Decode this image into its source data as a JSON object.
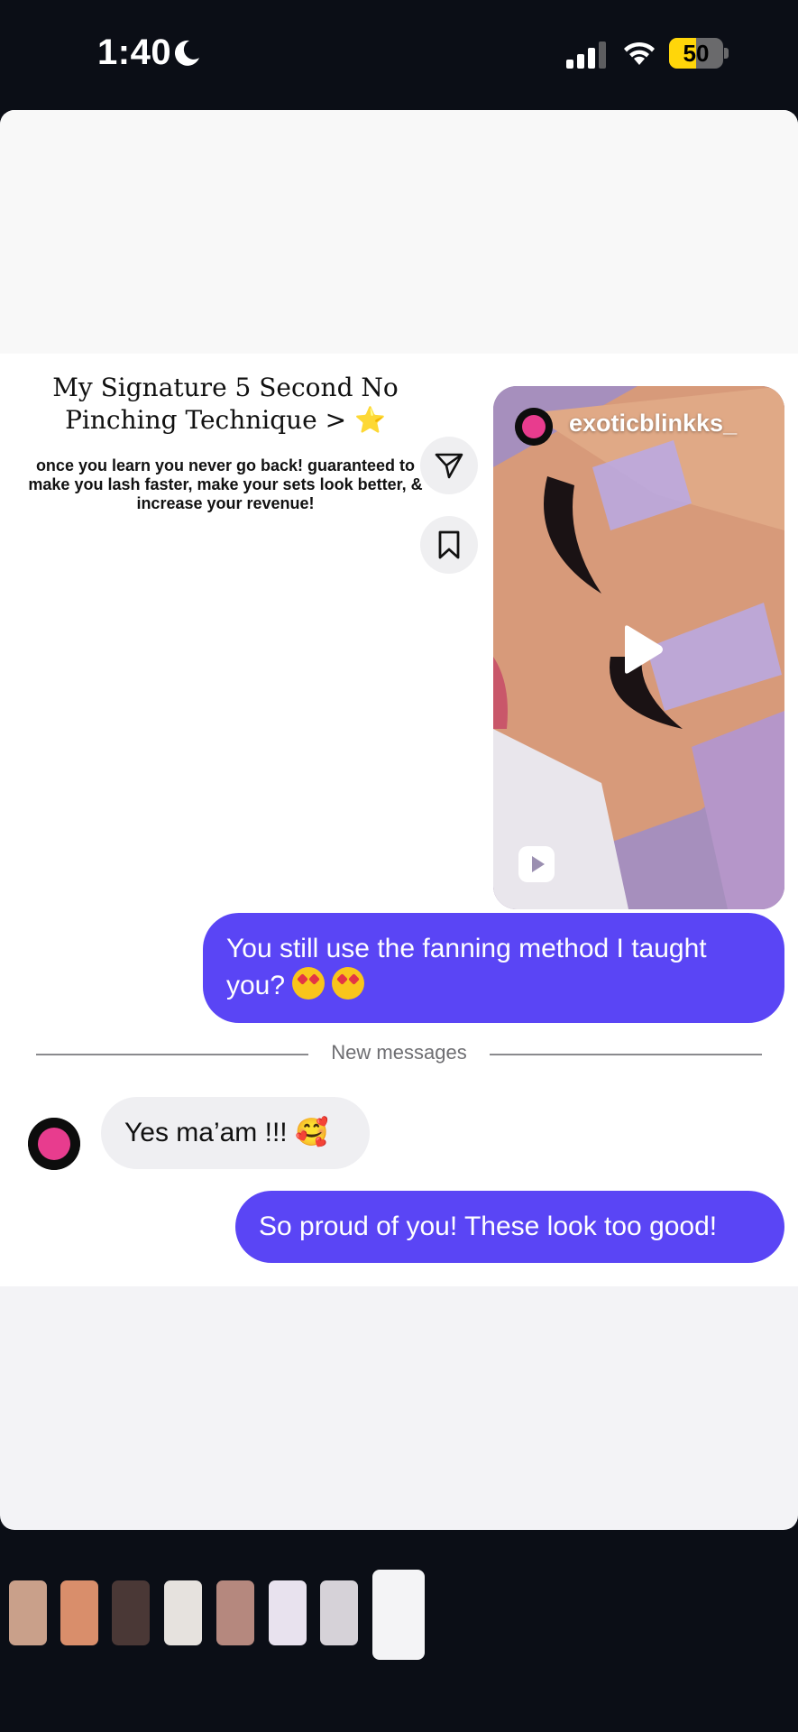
{
  "status_bar": {
    "time": "1:40",
    "battery_level": "50",
    "battery_color": "#ffd60a"
  },
  "post": {
    "title": "My Signature 5 Second No Pinching Technique > ⭐️",
    "subtitle": "once you learn you never go back! guaranteed to make you lash faster, make your sets look better, & increase your revenue!",
    "share_icon": "paper-plane-icon",
    "save_icon": "bookmark-icon"
  },
  "reel": {
    "username": "exoticblinkks_",
    "play_icon": "play-icon",
    "reel_icon": "reel-icon"
  },
  "messages": {
    "msg1": "You still use the fanning method I taught you?",
    "divider": "New messages",
    "msg2": "Yes ma’am !!! 🥰",
    "msg3": "So proud of you! These look too good!"
  },
  "colors": {
    "outgoing_bubble": "#5a45f5",
    "incoming_bubble": "#efeff2",
    "background": "#0b0e16"
  }
}
